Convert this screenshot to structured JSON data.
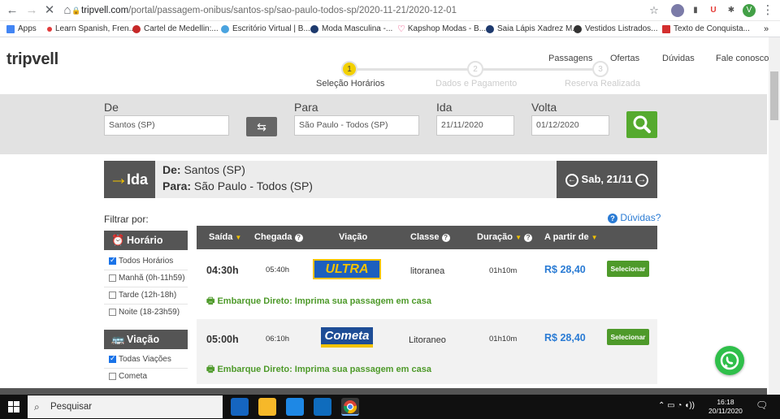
{
  "browser": {
    "url_host": "tripvell.com",
    "url_path": "/portal/passagem-onibus/santos-sp/sao-paulo-todos-sp/2020-11-21/2020-12-01",
    "bookmarks": [
      {
        "label": "Apps",
        "color": "#4285f4"
      },
      {
        "label": "Learn Spanish, Fren...",
        "color": "#e23b3b"
      },
      {
        "label": "Cartel de Medellin:...",
        "color": "#c62828"
      },
      {
        "label": "Escritório Virtual | B...",
        "color": "#4aa3df"
      },
      {
        "label": "Moda Masculina -...",
        "color": "#1e3a6e"
      },
      {
        "label": "Kapshop Modas - B...",
        "color": "#e91e63"
      },
      {
        "label": "Saia Lápis Xadrez M...",
        "color": "#1e3a6e"
      },
      {
        "label": "Vestidos Listrados...",
        "color": "#333333"
      },
      {
        "label": "Texto de Conquista...",
        "color": "#d32f2f"
      }
    ],
    "ext_letters": [
      "U",
      "V"
    ]
  },
  "site": {
    "logo": "tripvell",
    "nav": [
      "Passagens",
      "Ofertas",
      "Dúvidas",
      "Fale conosco"
    ],
    "steps": [
      {
        "num": "1",
        "label": "Seleção Horários",
        "active": true
      },
      {
        "num": "2",
        "label": "Dados e Pagamento",
        "active": false
      },
      {
        "num": "3",
        "label": "Reserva Realizada",
        "active": false
      }
    ]
  },
  "search": {
    "de_label": "De",
    "de_value": "Santos (SP)",
    "para_label": "Para",
    "para_value": "São Paulo - Todos (SP)",
    "ida_label": "Ida",
    "ida_value": "21/11/2020",
    "volta_label": "Volta",
    "volta_value": "01/12/2020"
  },
  "trip": {
    "direction": "Ida",
    "de_prefix": "De:",
    "de_city": "Santos (SP)",
    "para_prefix": "Para:",
    "para_city": "São Paulo - Todos (SP)",
    "date": "Sab, 21/11"
  },
  "filters": {
    "title": "Filtrar por:",
    "horario": {
      "title": "Horário",
      "items": [
        {
          "label": "Todos Horários",
          "checked": true
        },
        {
          "label": "Manhã (0h-11h59)",
          "checked": false
        },
        {
          "label": "Tarde (12h-18h)",
          "checked": false
        },
        {
          "label": "Noite (18-23h59)",
          "checked": false
        }
      ]
    },
    "viacao": {
      "title": "Viação",
      "items": [
        {
          "label": "Todas Viações",
          "checked": true
        },
        {
          "label": "Cometa",
          "checked": false
        }
      ]
    }
  },
  "results": {
    "help": "Dúvidas?",
    "columns": [
      "Saída",
      "Chegada",
      "Viação",
      "Classe",
      "Duração",
      "A partir de"
    ],
    "select_label": "Selecionar",
    "rows": [
      {
        "saida": "04:30h",
        "chegada": "05:40h",
        "viacao": "ULTRA",
        "classe": "litoranea",
        "duracao": "01h10m",
        "preco": "R$ 28,40",
        "embarque": "Embarque Direto: Imprima sua passagem em casa"
      },
      {
        "saida": "05:00h",
        "chegada": "06:10h",
        "viacao": "Cometa",
        "classe": "Litoraneo",
        "duracao": "01h10m",
        "preco": "R$ 28,40",
        "embarque": "Embarque Direto: Imprima sua passagem em casa"
      }
    ]
  },
  "taskbar": {
    "search_placeholder": "Pesquisar",
    "time": "16:18",
    "date": "20/11/2020"
  }
}
